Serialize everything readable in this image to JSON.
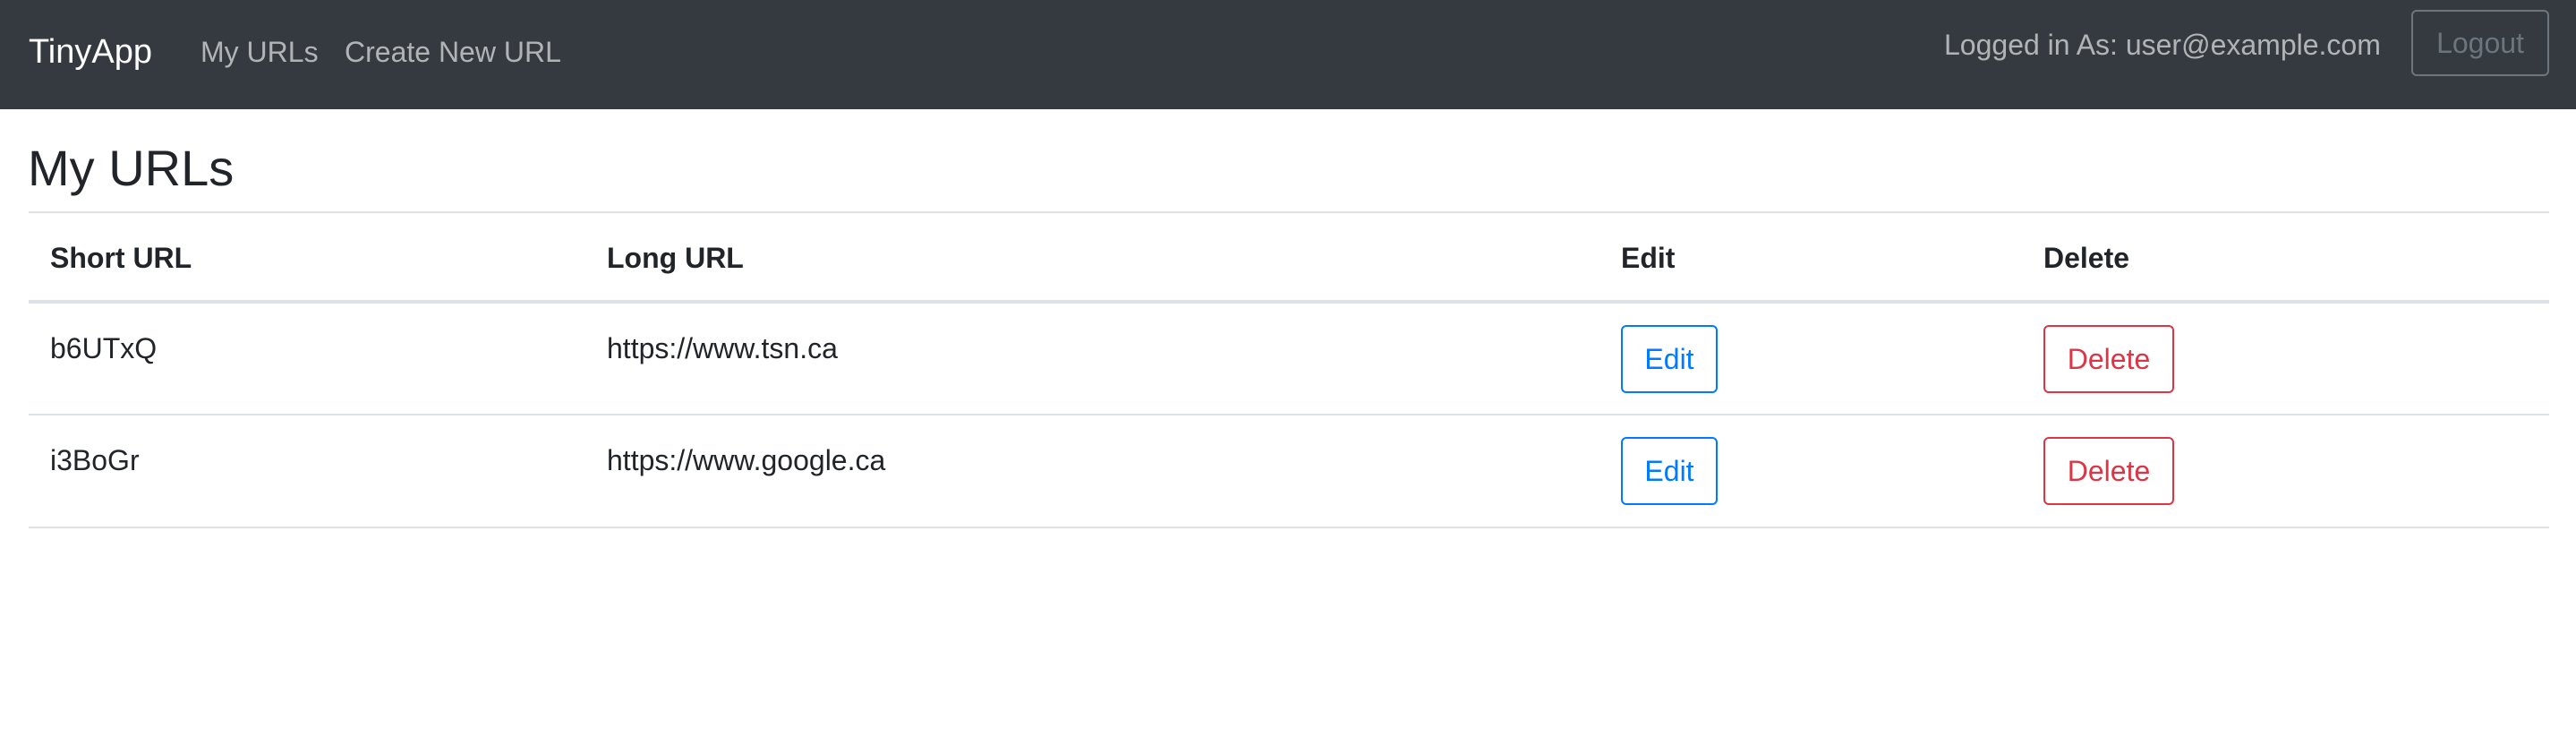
{
  "navbar": {
    "brand": "TinyApp",
    "links": [
      {
        "label": "My URLs"
      },
      {
        "label": "Create New URL"
      }
    ],
    "logged_in_text": "Logged in As: user@example.com",
    "logout_label": "Logout"
  },
  "main": {
    "title": "My URLs",
    "table": {
      "columns": [
        "Short URL",
        "Long URL",
        "Edit",
        "Delete"
      ],
      "rows": [
        {
          "short_url": "b6UTxQ",
          "long_url": "https://www.tsn.ca",
          "edit_label": "Edit",
          "delete_label": "Delete"
        },
        {
          "short_url": "i3BoGr",
          "long_url": "https://www.google.ca",
          "edit_label": "Edit",
          "delete_label": "Delete"
        }
      ]
    }
  },
  "colors": {
    "navbar_bg": "#343a40",
    "primary": "#007bff",
    "danger": "#dc3545",
    "secondary": "#6c757d"
  }
}
